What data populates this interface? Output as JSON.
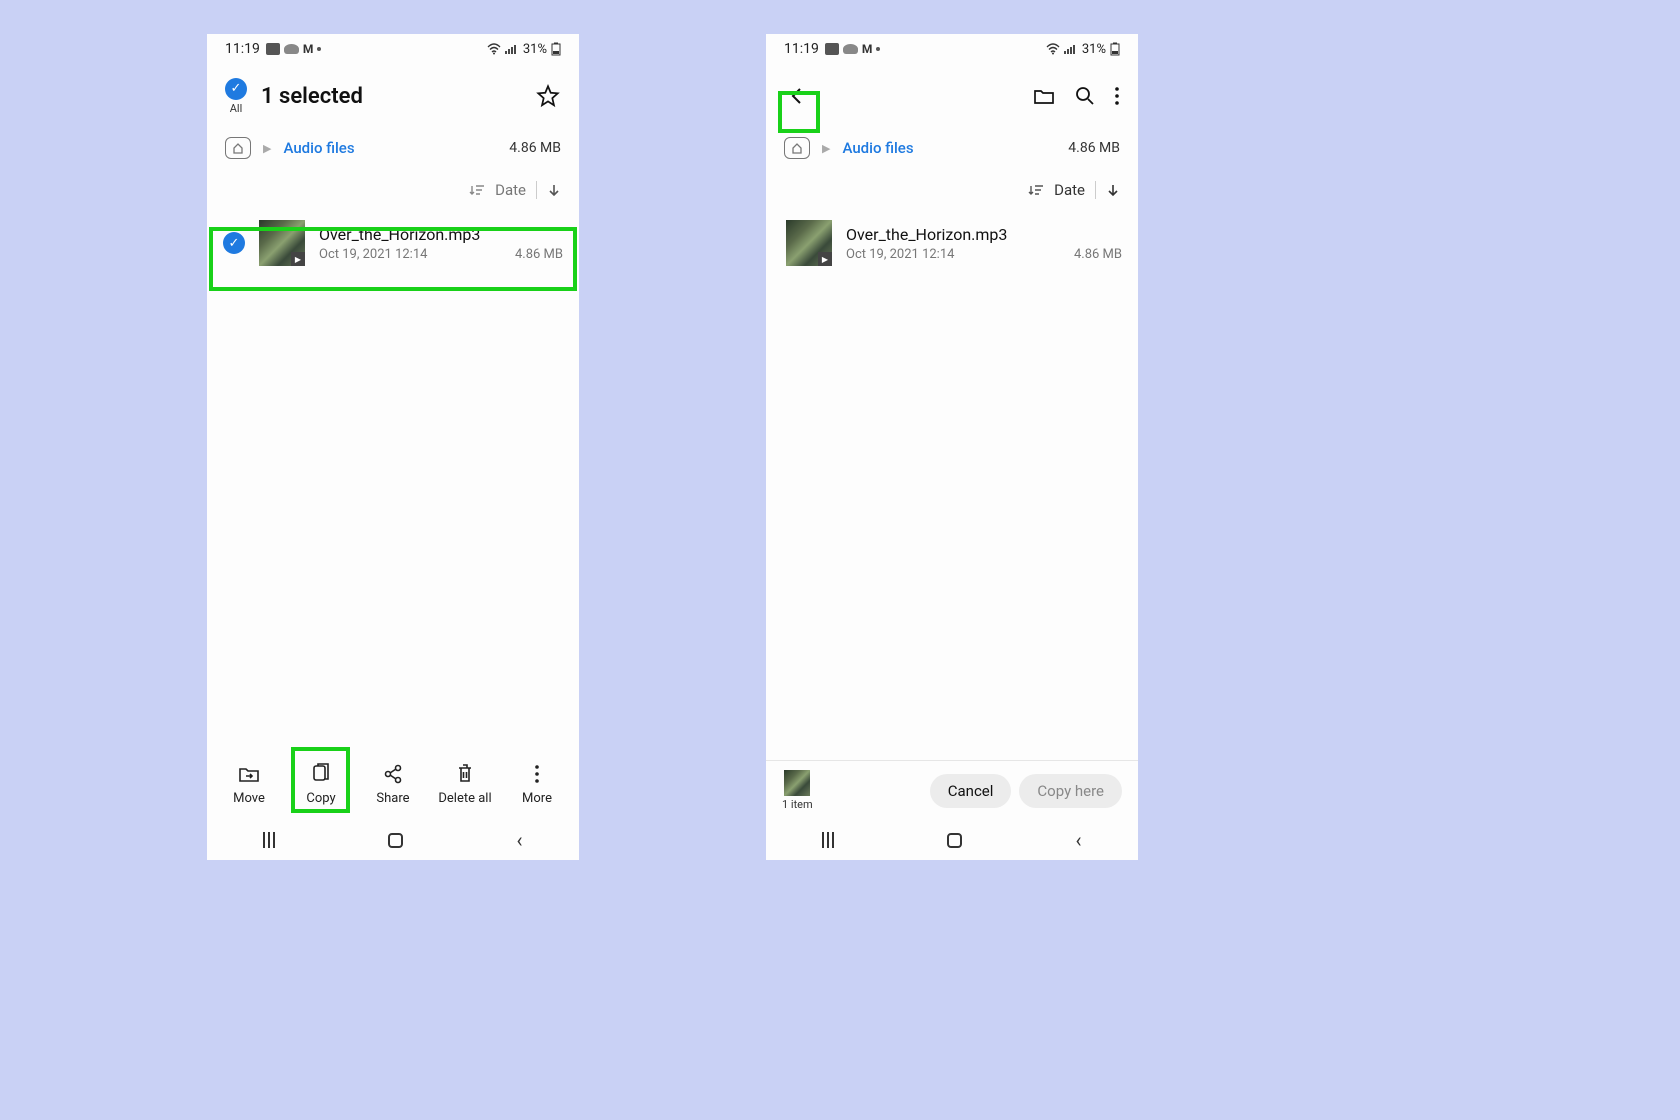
{
  "status": {
    "time": "11:19",
    "battery": "31%"
  },
  "left": {
    "select_all_label": "All",
    "title": "1 selected",
    "breadcrumb": {
      "link": "Audio files",
      "size": "4.86 MB"
    },
    "sort": {
      "label": "Date"
    },
    "file": {
      "name": "Over_the_Horizon.mp3",
      "date": "Oct 19, 2021 12:14",
      "size": "4.86 MB"
    },
    "actions": {
      "move": "Move",
      "copy": "Copy",
      "share": "Share",
      "delete_all": "Delete all",
      "more": "More"
    }
  },
  "right": {
    "breadcrumb": {
      "link": "Audio files",
      "size": "4.86 MB"
    },
    "sort": {
      "label": "Date"
    },
    "file": {
      "name": "Over_the_Horizon.mp3",
      "date": "Oct 19, 2021 12:14",
      "size": "4.86 MB"
    },
    "copy_bar": {
      "item_count": "1 item",
      "cancel": "Cancel",
      "copy_here": "Copy here"
    }
  }
}
